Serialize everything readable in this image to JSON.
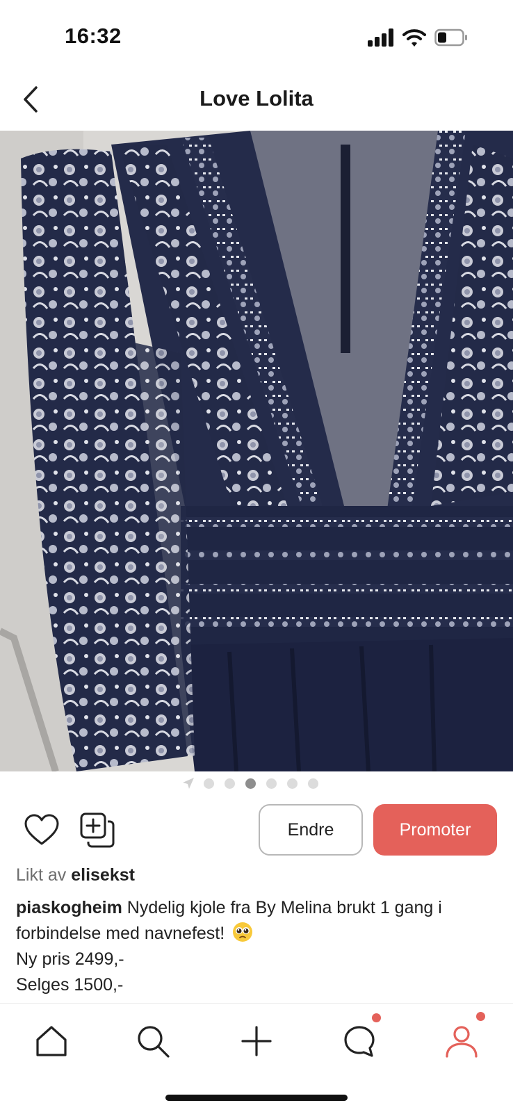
{
  "status_bar": {
    "time": "16:32",
    "icons": [
      "cellular-signal-icon",
      "wifi-icon",
      "battery-icon"
    ]
  },
  "header": {
    "title": "Love Lolita",
    "back_icon": "chevron-left-icon"
  },
  "photo": {
    "description_icon": "product-photo",
    "pager": {
      "total": 6,
      "active_index": 2,
      "leading_icon": "location-arrow-icon"
    }
  },
  "actions": {
    "like_icon": "heart-outline-icon",
    "save_icon": "add-to-collection-icon",
    "edit_label": "Endre",
    "promote_label": "Promoter"
  },
  "likes": {
    "prefix": "Likt av",
    "user": "elisekst"
  },
  "caption": {
    "user": "piaskogheim",
    "text": "Nydelig kjole fra By Melina brukt 1 gang i forbindelse med navnefest!",
    "emoji": "pleading-face-emoji",
    "price_new": "Ny pris 2499,-",
    "price_sale": "Selges 1500,-"
  },
  "tab_bar": {
    "tabs": [
      {
        "name": "home",
        "icon": "home-icon",
        "badge": false,
        "active": false
      },
      {
        "name": "search",
        "icon": "search-icon",
        "badge": false,
        "active": false
      },
      {
        "name": "add",
        "icon": "plus-icon",
        "badge": false,
        "active": false
      },
      {
        "name": "messages",
        "icon": "chat-bubble-icon",
        "badge": true,
        "active": false
      },
      {
        "name": "profile",
        "icon": "profile-icon",
        "badge": true,
        "active": true
      }
    ]
  },
  "colors": {
    "accent": "#e4615a",
    "text": "#222222",
    "muted": "#6e6e6e",
    "border": "#b8b8b8",
    "dress_navy": "#1f2540"
  }
}
